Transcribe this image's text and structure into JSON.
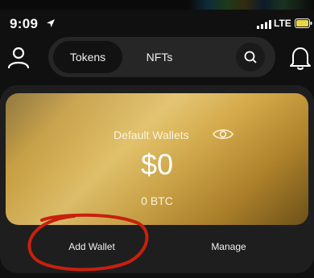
{
  "status_bar": {
    "time": "9:09",
    "network": "LTE"
  },
  "header": {
    "tabs": [
      {
        "label": "Tokens",
        "active": true
      },
      {
        "label": "NFTs",
        "active": false
      }
    ],
    "icons": [
      "person-icon",
      "search-icon",
      "bell-icon"
    ]
  },
  "wallet_card": {
    "title": "Default Wallets",
    "balance": "$0",
    "btc_balance": "0 BTC"
  },
  "actions": {
    "add_label": "Add Wallet",
    "manage_label": "Manage"
  },
  "annotation": {
    "color": "#c8200e",
    "target": "Add Wallet"
  },
  "colors": {
    "background": "#101010",
    "panel": "#1e1e1e",
    "tab_bar": "#262626",
    "card_gold": "#d4aa4a"
  }
}
